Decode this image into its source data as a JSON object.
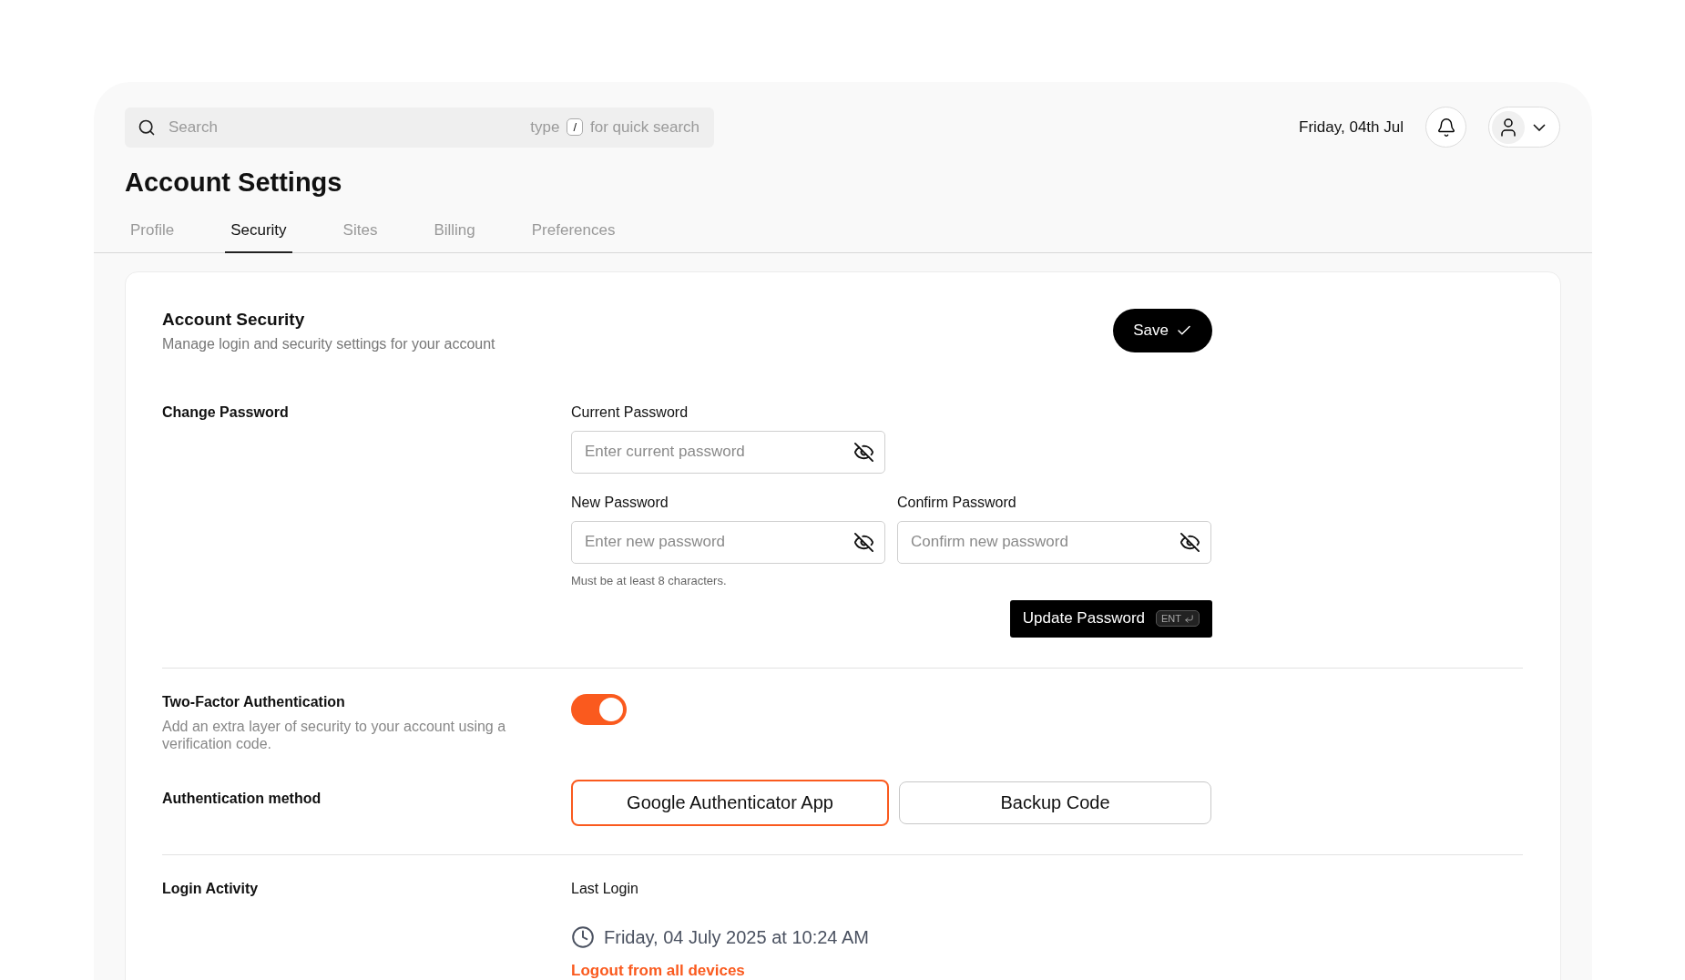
{
  "search": {
    "placeholder": "Search",
    "hint_before": "type",
    "key": "/",
    "hint_after": "for quick search"
  },
  "header": {
    "date": "Friday, 04th Jul"
  },
  "title": "Account Settings",
  "tabs": [
    {
      "label": "Profile",
      "selected": false
    },
    {
      "label": "Security",
      "selected": true
    },
    {
      "label": "Sites",
      "selected": false
    },
    {
      "label": "Billing",
      "selected": false
    },
    {
      "label": "Preferences",
      "selected": false
    }
  ],
  "security": {
    "title": "Account Security",
    "subtitle": "Manage login and security settings for your account",
    "save": "Save"
  },
  "change_password": {
    "label": "Change Password",
    "current": {
      "label": "Current Password",
      "placeholder": "Enter current password"
    },
    "new": {
      "label": "New Password",
      "placeholder": "Enter new password",
      "hint": "Must be at least 8 characters."
    },
    "confirm": {
      "label": "Confirm Password",
      "placeholder": "Confirm new password"
    },
    "update": "Update Password",
    "update_key": "ENT"
  },
  "two_factor": {
    "title": "Two-Factor Authentication",
    "description": "Add an extra layer of security to your account using a verification code.",
    "on": true
  },
  "auth_method": {
    "label": "Authentication method",
    "options": [
      {
        "label": "Google Authenticator App",
        "selected": true
      },
      {
        "label": "Backup Code",
        "selected": false
      }
    ]
  },
  "login_activity": {
    "label": "Login Activity",
    "last_login_label": "Last Login",
    "last_login": "Friday, 04 July 2025 at 10:24 AM",
    "logout": "Logout from all devices"
  }
}
